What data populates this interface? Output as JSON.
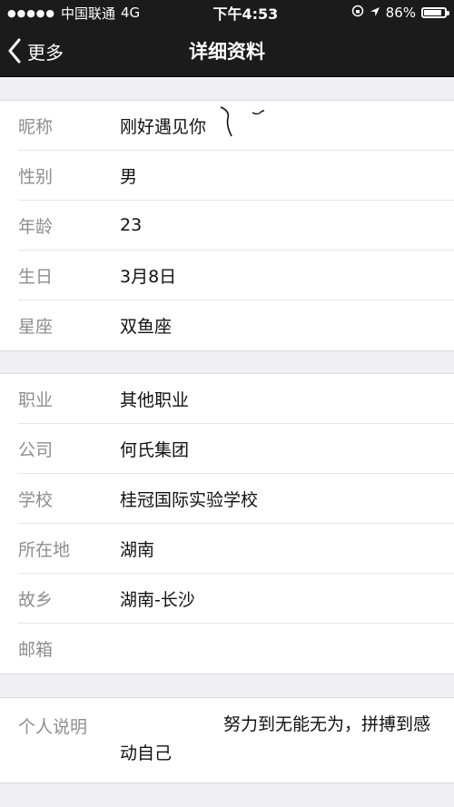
{
  "status_bar": {
    "carrier": "中国联通",
    "network": "4G",
    "time": "下午4:53",
    "battery": "86%",
    "battery_level": 0.86
  },
  "nav": {
    "back_label": "更多",
    "title": "详细资料"
  },
  "profile": {
    "section1": [
      {
        "label": "昵称",
        "value": "刚好遇见你"
      },
      {
        "label": "性别",
        "value": "男"
      },
      {
        "label": "年龄",
        "value": "23"
      },
      {
        "label": "生日",
        "value": "3月8日"
      },
      {
        "label": "星座",
        "value": "双鱼座"
      }
    ],
    "section2": [
      {
        "label": "职业",
        "value": "其他职业"
      },
      {
        "label": "公司",
        "value": "何氏集团"
      },
      {
        "label": "学校",
        "value": "桂冠国际实验学校"
      },
      {
        "label": "所在地",
        "value": "湖南"
      },
      {
        "label": "故乡",
        "value": "湖南-长沙"
      },
      {
        "label": "邮箱",
        "value": ""
      }
    ],
    "description": {
      "label": "个人说明",
      "value": "　　　　　　努力到无能无为，拼搏到感动自己"
    }
  }
}
